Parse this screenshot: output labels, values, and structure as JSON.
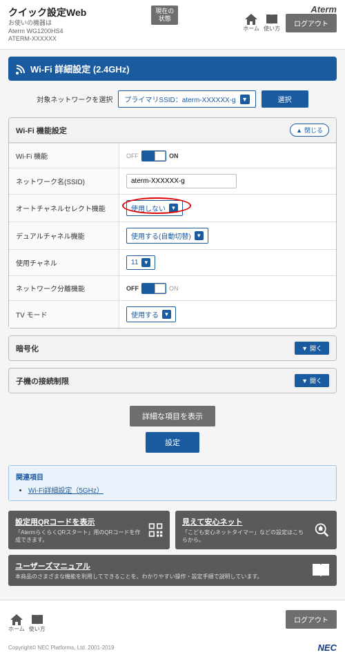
{
  "header": {
    "title": "クイック設定Web",
    "sub1": "お使いの機器は",
    "sub2": "Aterm WG1200HS4",
    "sub3": "ATERM-XXXXXX",
    "brand": "Aterm",
    "status": "現在の\n状態",
    "home": "ホーム",
    "usage": "使い方",
    "logout": "ログアウト"
  },
  "title": "Wi-Fi 詳細設定 (2.4GHz)",
  "selector": {
    "label": "対象ネットワークを選択",
    "value": "プライマリSSID：aterm-XXXXXX-g",
    "button": "選択"
  },
  "panel1": {
    "title": "Wi-Fi 機能設定",
    "collapse": "閉じる",
    "rows": {
      "wifi": {
        "label": "Wi-Fi 機能",
        "off": "OFF",
        "on": "ON"
      },
      "ssid": {
        "label": "ネットワーク名(SSID)",
        "value": "aterm-XXXXXX-g"
      },
      "auto": {
        "label": "オートチャネルセレクト機能",
        "value": "使用しない"
      },
      "dual": {
        "label": "デュアルチャネル機能",
        "value": "使用する(自動切替)"
      },
      "ch": {
        "label": "使用チャネル",
        "value": "11"
      },
      "sep": {
        "label": "ネットワーク分離機能",
        "off": "OFF",
        "on": "ON"
      },
      "tv": {
        "label": "TV モード",
        "value": "使用する"
      }
    }
  },
  "panel2": {
    "title": "暗号化",
    "expand": "開く"
  },
  "panel3": {
    "title": "子機の接続制限",
    "expand": "開く"
  },
  "buttons": {
    "detail": "詳細な項目を表示",
    "set": "設定"
  },
  "related": {
    "title": "関連項目",
    "link1": "Wi-Fi詳細設定（5GHz）"
  },
  "cards": {
    "qr": {
      "title": "設定用QRコードを表示",
      "desc": "「AtermらくらくQRスタート」用のQRコードを作成できます。"
    },
    "safe": {
      "title": "見えて安心ネット",
      "desc": "「こども安心ネットタイマー」などの設定はこちらから。"
    },
    "manual": {
      "title": "ユーザーズマニュアル",
      "desc": "本商品のさまざまな機能を利用してできることを、わかりやすい操作・設定手順で説明しています。"
    }
  },
  "footer": {
    "copyright": "Copyright© NEC Platforms, Ltd. 2001-2019",
    "nec": "NEC"
  }
}
